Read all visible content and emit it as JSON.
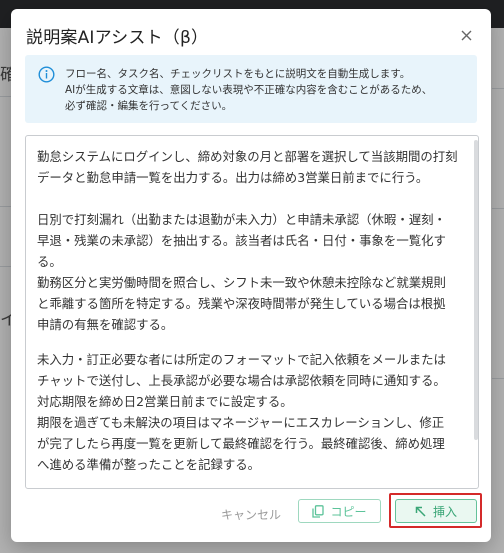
{
  "background": {
    "fragments": [
      "確",
      "イ"
    ]
  },
  "dialog": {
    "title": "説明案AIアシスト（β）",
    "info_lines": [
      "フロー名、タスク名、チェックリストをもとに説明文を自動生成します。",
      "AIが生成する文章は、意図しない表現や不正確な内容を含むことがあるため、",
      "必ず確認・編集を行ってください。"
    ],
    "paragraphs": [
      [
        "勤怠システムにログインし、締め対象の月と部署を選択して当該期間の打刻",
        "データと勤怠申請一覧を出力する。出力は締め3営業日前までに行う。"
      ],
      [
        "日別で打刻漏れ（出勤または退勤が未入力）と申請未承認（休暇・遅刻・",
        "早退・残業の未承認）を抽出する。該当者は氏名・日付・事象を一覧化す",
        "る。"
      ],
      [
        "勤務区分と実労働時間を照合し、シフト未一致や休憩未控除など就業規則",
        "と乖離する箇所を特定する。残業や深夜時間帯が発生している場合は根拠",
        "申請の有無を確認する。"
      ],
      [
        "未入力・訂正必要な者には所定のフォーマットで記入依頼をメールまたは",
        "チャットで送付し、上長承認が必要な場合は承認依頼を同時に通知する。",
        "対応期限を締め日2営業日前までに設定する。"
      ],
      [
        "期限を過ぎても未解決の項目はマネージャーにエスカレーションし、修正",
        "が完了したら再度一覧を更新して最終確認を行う。最終確認後、締め処理",
        "へ進める準備が整ったことを記録する。"
      ]
    ],
    "buttons": {
      "cancel": "キャンセル",
      "copy": "コピー",
      "insert": "挿入"
    }
  },
  "colors": {
    "accent_green": "#3aa677",
    "info_blue": "#1f8ed8",
    "highlight_red": "#d42a2a"
  }
}
